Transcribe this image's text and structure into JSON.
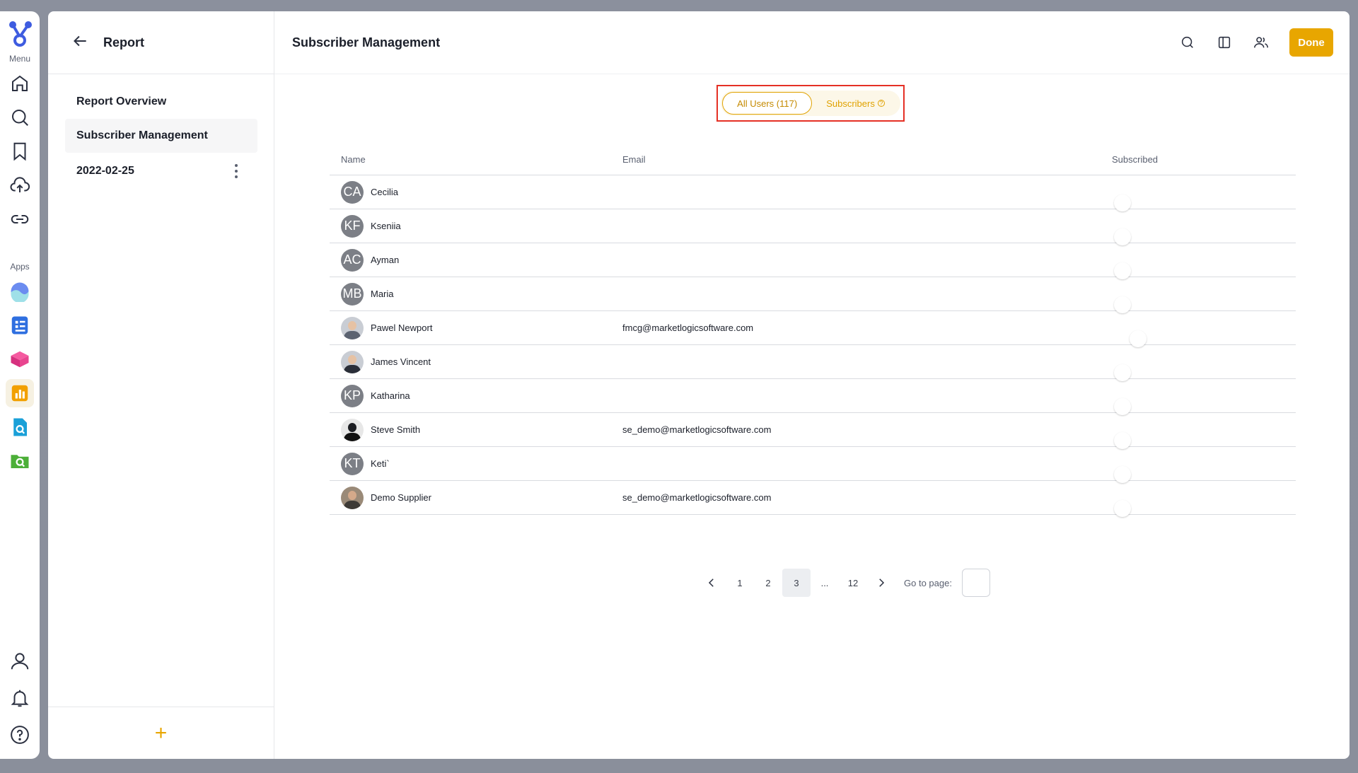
{
  "rail": {
    "menu_caption": "Menu",
    "apps_caption": "Apps",
    "menu_icons": [
      "home-icon",
      "search-icon",
      "bookmark-icon",
      "upload-icon",
      "link-icon"
    ],
    "app_icons": [
      "wave-app-icon",
      "form-app-icon",
      "cube-app-icon",
      "chart-app-icon",
      "doc-search-app-icon",
      "folder-search-app-icon"
    ],
    "bottom_icons": [
      "user-icon",
      "bell-icon",
      "help-icon"
    ]
  },
  "left_pane": {
    "title": "Report",
    "items": [
      {
        "label": "Report Overview"
      },
      {
        "label": "Subscriber Management"
      },
      {
        "label": "2022-02-25"
      }
    ],
    "add_symbol": "+"
  },
  "header": {
    "title": "Subscriber Management",
    "done_label": "Done"
  },
  "filter": {
    "all_users": "All Users (117)",
    "subscribers": "Subscribers",
    "info_symbol": "?"
  },
  "table": {
    "columns": {
      "name": "Name",
      "email": "Email",
      "subscribed": "Subscribed"
    },
    "rows": [
      {
        "initials": "CA",
        "name": "Cecilia",
        "email": "",
        "subscribed": false
      },
      {
        "initials": "KF",
        "name": "Kseniia",
        "email": "",
        "subscribed": false
      },
      {
        "initials": "AC",
        "name": "Ayman",
        "email": "",
        "subscribed": false
      },
      {
        "initials": "MB",
        "name": "Maria",
        "email": "",
        "subscribed": false
      },
      {
        "initials": "",
        "name": "Pawel Newport",
        "email": "fmcg@marketlogicsoftware.com",
        "subscribed": true
      },
      {
        "initials": "",
        "name": "James Vincent",
        "email": "",
        "subscribed": false
      },
      {
        "initials": "KP",
        "name": "Katharina",
        "email": "",
        "subscribed": false
      },
      {
        "initials": "",
        "name": "Steve Smith",
        "email": "se_demo@marketlogicsoftware.com",
        "subscribed": false
      },
      {
        "initials": "KT",
        "name": "Keti`",
        "email": "",
        "subscribed": false
      },
      {
        "initials": "",
        "name": "Demo Supplier",
        "email": "se_demo@marketlogicsoftware.com",
        "subscribed": false
      }
    ]
  },
  "pagination": {
    "pages": [
      "1",
      "2",
      "3",
      "...",
      "12"
    ],
    "current": "3",
    "goto_label": "Go to page:"
  },
  "colors": {
    "accent": "#e8a600",
    "highlight_border": "#e53025"
  }
}
